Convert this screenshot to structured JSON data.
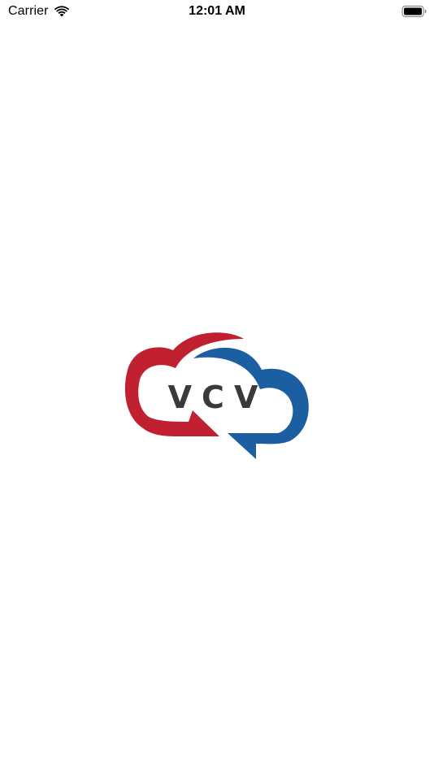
{
  "status_bar": {
    "carrier": "Carrier",
    "time": "12:01 AM",
    "wifi_icon": "wifi-icon",
    "battery_icon": "battery-icon"
  },
  "splash": {
    "logo_text": "VCV",
    "logo_icon": "vcv-cloud-logo",
    "colors": {
      "red": "#c0202f",
      "blue": "#1b5ea2",
      "text": "#3a3a3a"
    }
  }
}
